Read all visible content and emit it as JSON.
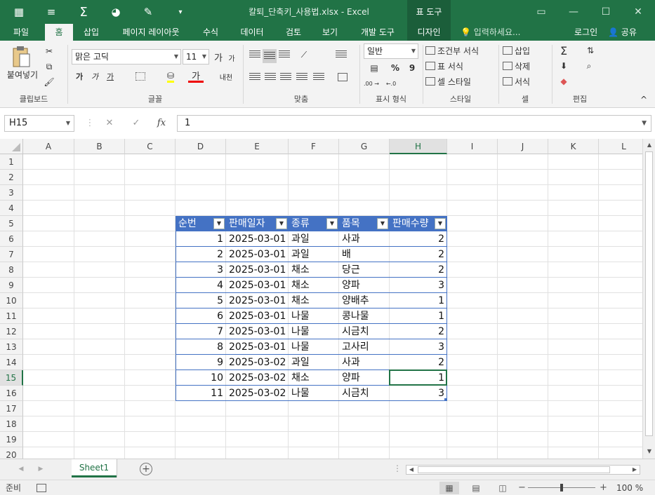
{
  "window": {
    "title": "칼퇴_단축키_사용법.xlsx - Excel",
    "context_label": "표 도구",
    "min_icon": "▭",
    "restore_icon": "—",
    "max_icon": "☐",
    "close_icon": "✕"
  },
  "quick_access": {
    "save_icon": "▦",
    "menu_icon": "≡",
    "autosum_icon": "Σ",
    "chart_icon": "◕",
    "brush_icon": "✎",
    "customize_icon": "▾"
  },
  "tabs": [
    "파일",
    "홈",
    "삽입",
    "페이지 레이아웃",
    "수식",
    "데이터",
    "검토",
    "보기",
    "개발 도구",
    "디자인"
  ],
  "tell_me": "입력하세요...",
  "tell_me_icon": "💡",
  "login": "로그인",
  "share": "공유",
  "share_icon": "👤",
  "ribbon": {
    "clipboard": {
      "paste": "붙여넣기",
      "label": "클립보드"
    },
    "font": {
      "name": "맑은 고딕",
      "size": "11",
      "grow": "가",
      "shrink": "가",
      "bold": "가",
      "italic": "가",
      "underline": "가",
      "fontcolor": "가",
      "phonetic": "내천",
      "label": "글꼴"
    },
    "align": {
      "label": "맞춤"
    },
    "number": {
      "format": "일반",
      "percent": "%",
      "comma": "9",
      "inc": ".00 →",
      "dec": "←.0",
      "label": "표시 형식"
    },
    "styles": {
      "conditional": "조건부 서식",
      "table": "표 서식",
      "cell": "셀 스타일",
      "label": "스타일"
    },
    "cells": {
      "insert": "삽입",
      "delete": "삭제",
      "format": "서식",
      "label": "셀"
    },
    "edit": {
      "label": "편집"
    },
    "collapse": "^"
  },
  "formula_bar": {
    "name_box": "H15",
    "cancel": "✕",
    "enter": "✓",
    "fx": "fx",
    "value": "1"
  },
  "columns": [
    "A",
    "B",
    "C",
    "D",
    "E",
    "F",
    "G",
    "H",
    "I",
    "J",
    "K",
    "L"
  ],
  "rows": [
    "1",
    "2",
    "3",
    "4",
    "5",
    "6",
    "7",
    "8",
    "9",
    "10",
    "11",
    "12",
    "13",
    "14",
    "15",
    "16",
    "17",
    "18",
    "19",
    "20"
  ],
  "selected_cell": {
    "col": "H",
    "row": "15"
  },
  "table": {
    "headers": [
      "순번",
      "판매일자",
      "종류",
      "품목",
      "판매수량"
    ],
    "rows": [
      [
        "1",
        "2025-03-01",
        "과일",
        "사과",
        "2"
      ],
      [
        "2",
        "2025-03-01",
        "과일",
        "배",
        "2"
      ],
      [
        "3",
        "2025-03-01",
        "채소",
        "당근",
        "2"
      ],
      [
        "4",
        "2025-03-01",
        "채소",
        "양파",
        "3"
      ],
      [
        "5",
        "2025-03-01",
        "채소",
        "양배추",
        "1"
      ],
      [
        "6",
        "2025-03-01",
        "나물",
        "콩나물",
        "1"
      ],
      [
        "7",
        "2025-03-01",
        "나물",
        "시금치",
        "2"
      ],
      [
        "8",
        "2025-03-01",
        "나물",
        "고사리",
        "3"
      ],
      [
        "9",
        "2025-03-02",
        "과일",
        "사과",
        "2"
      ],
      [
        "10",
        "2025-03-02",
        "채소",
        "양파",
        "1"
      ],
      [
        "11",
        "2025-03-02",
        "나물",
        "시금치",
        "3"
      ]
    ]
  },
  "sheet_tab": "Sheet1",
  "add_sheet": "+",
  "status": {
    "ready": "준비",
    "zoom": "100 %",
    "zoom_minus": "−",
    "zoom_plus": "+"
  }
}
